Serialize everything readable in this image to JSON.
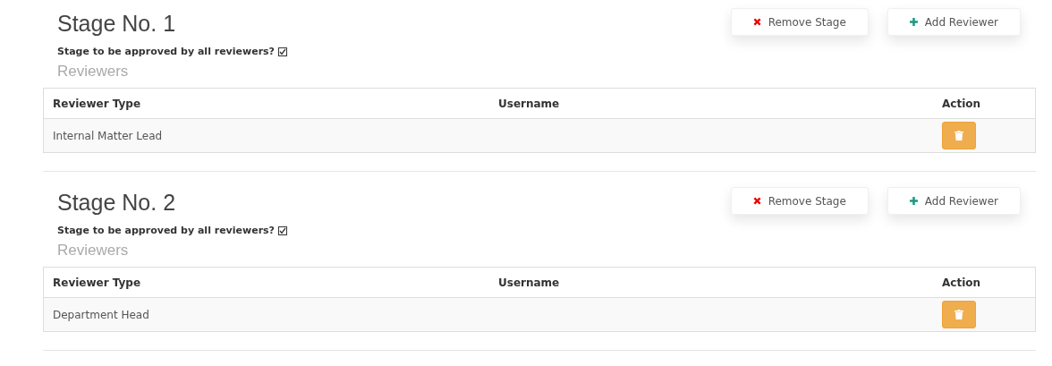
{
  "stages": [
    {
      "title": "Stage No. 1",
      "approve_all": {
        "label": "Stage to be approved by all reviewers?",
        "checked": true
      },
      "buttons": [
        {
          "kind": "remove",
          "label": "Remove Stage"
        },
        {
          "kind": "add",
          "label": "Add Reviewer"
        }
      ],
      "section_title": "Reviewers",
      "table": {
        "columns": [
          "Reviewer Type",
          "Username",
          "Action"
        ],
        "rows": [
          {
            "reviewer_type": "Internal Matter Lead"
          }
        ]
      }
    },
    {
      "title": "Stage No. 2",
      "approve_all": {
        "label": "Stage to be approved by all reviewers?",
        "checked": true
      },
      "buttons": [
        {
          "kind": "remove",
          "label": "Remove Stage"
        },
        {
          "kind": "add",
          "label": "Add Reviewer"
        }
      ],
      "section_title": "Reviewers",
      "table": {
        "columns": [
          "Reviewer Type",
          "Username",
          "Action"
        ],
        "rows": [
          {
            "reviewer_type": "Department Head"
          }
        ]
      }
    }
  ]
}
